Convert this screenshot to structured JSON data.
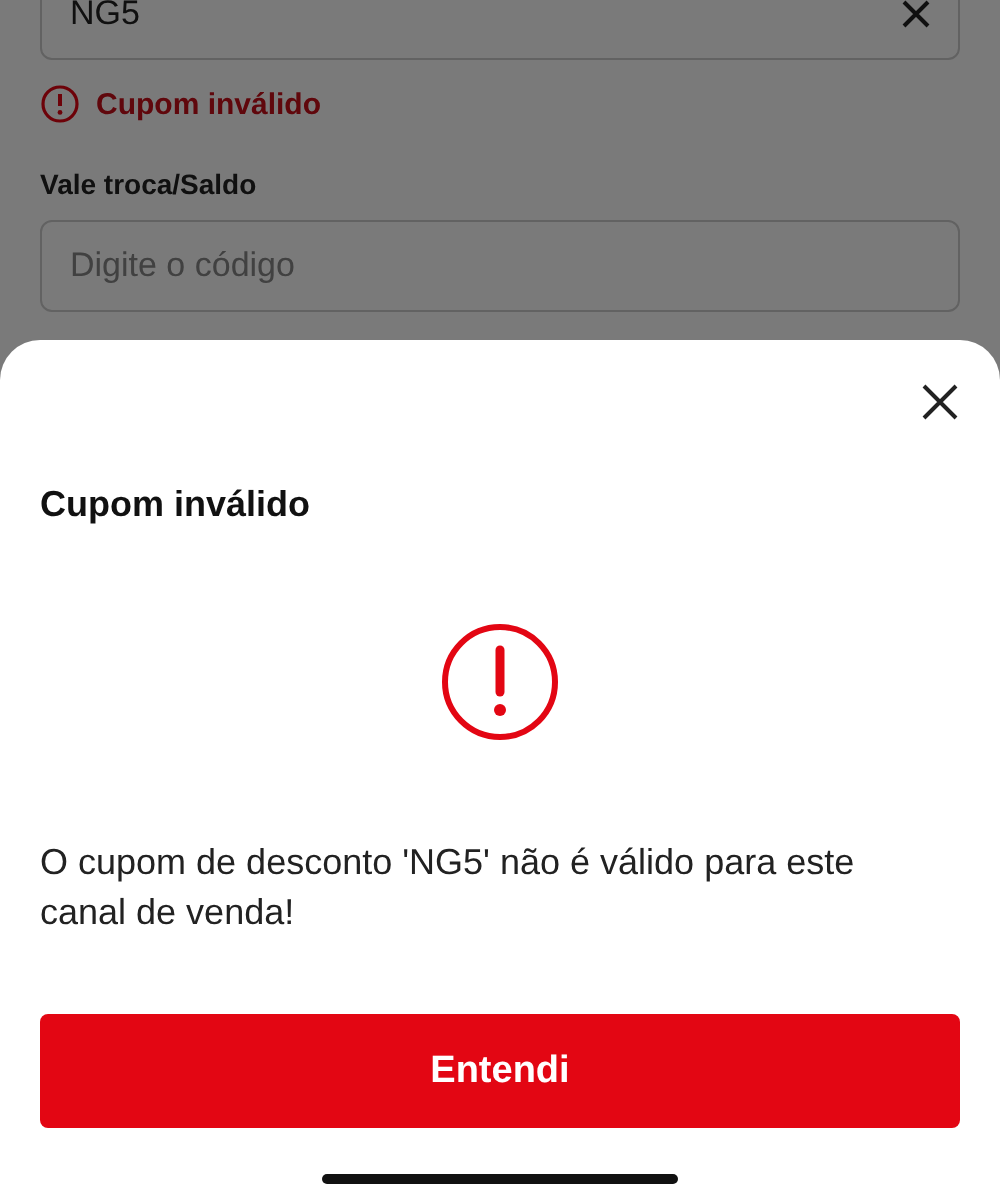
{
  "coupon_field": {
    "value": "NG5",
    "error": "Cupom inválido"
  },
  "voucher_field": {
    "label": "Vale troca/Saldo",
    "placeholder": "Digite o código"
  },
  "dialog": {
    "title": "Cupom inválido",
    "message": "O cupom de desconto 'NG5' não é válido para este canal de venda!",
    "button": "Entendi"
  }
}
